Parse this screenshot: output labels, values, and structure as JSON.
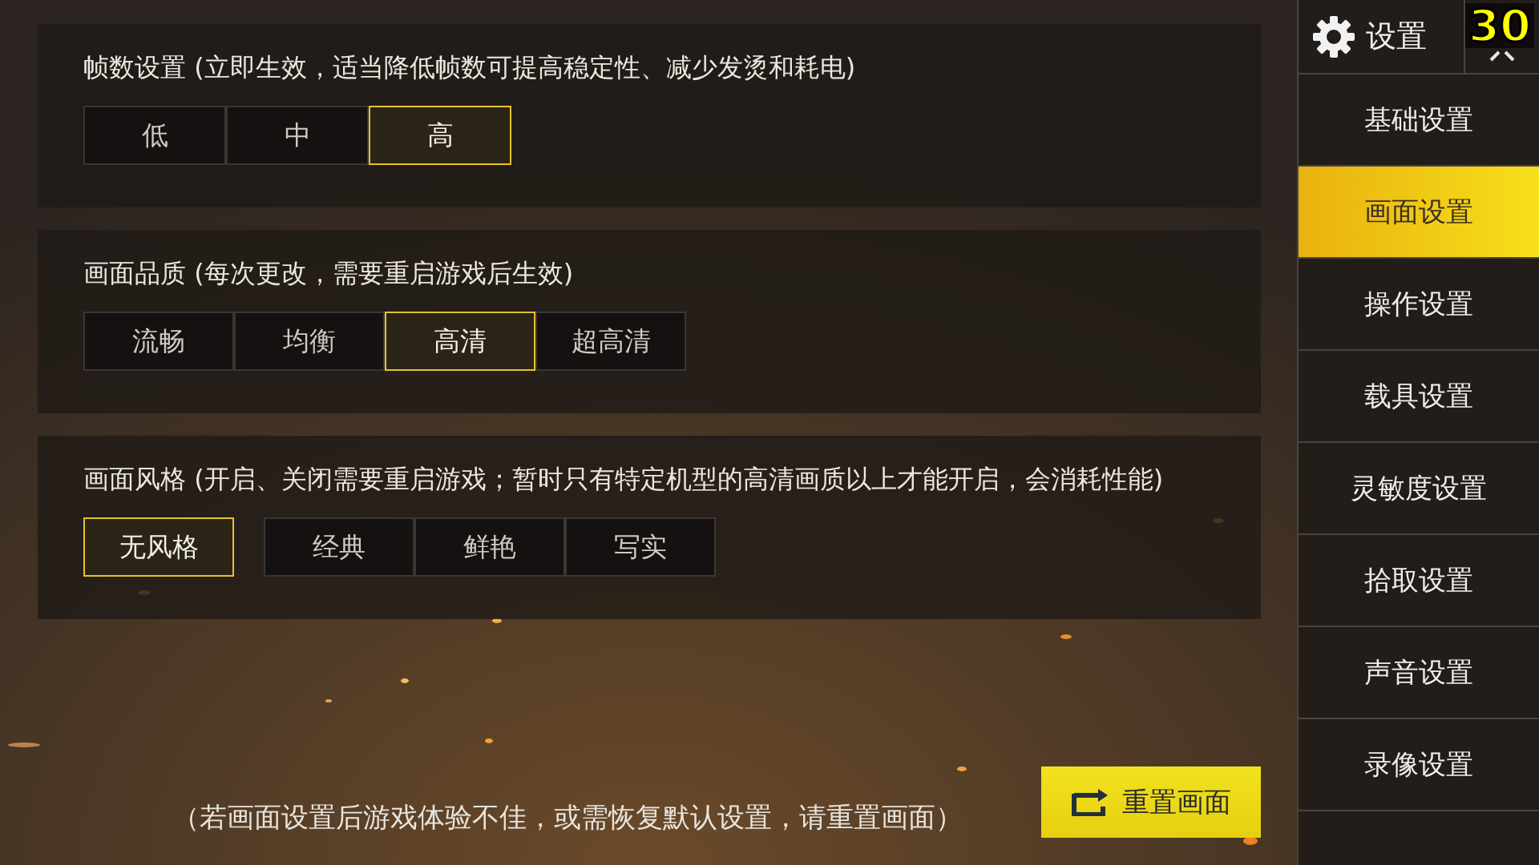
{
  "fps_counter": "30",
  "sections": [
    {
      "title": "帧数设置 (立即生效，适当降低帧数可提高稳定性、减少发烫和耗电)",
      "options": [
        {
          "label": "低",
          "selected": false
        },
        {
          "label": "中",
          "selected": false
        },
        {
          "label": "高",
          "selected": true
        }
      ]
    },
    {
      "title": "画面品质 (每次更改，需要重启游戏后生效)",
      "options": [
        {
          "label": "流畅",
          "selected": false
        },
        {
          "label": "均衡",
          "selected": false
        },
        {
          "label": "高清",
          "selected": true
        },
        {
          "label": "超高清",
          "selected": false
        }
      ]
    },
    {
      "title": "画面风格 (开启、关闭需要重启游戏；暂时只有特定机型的高清画质以上才能开启，会消耗性能)",
      "options": [
        {
          "label": "无风格",
          "selected": true
        },
        {
          "label": "经典",
          "selected": false
        },
        {
          "label": "鲜艳",
          "selected": false
        },
        {
          "label": "写实",
          "selected": false
        }
      ]
    }
  ],
  "hint": "（若画面设置后游戏体验不佳，或需恢复默认设置，请重置画面）",
  "reset_button": "重置画面",
  "sidebar": {
    "title": "设置",
    "items": [
      {
        "label": "基础设置",
        "selected": false
      },
      {
        "label": "画面设置",
        "selected": true
      },
      {
        "label": "操作设置",
        "selected": false
      },
      {
        "label": "载具设置",
        "selected": false
      },
      {
        "label": "灵敏度设置",
        "selected": false
      },
      {
        "label": "拾取设置",
        "selected": false
      },
      {
        "label": "声音设置",
        "selected": false
      },
      {
        "label": "录像设置",
        "selected": false
      }
    ]
  }
}
